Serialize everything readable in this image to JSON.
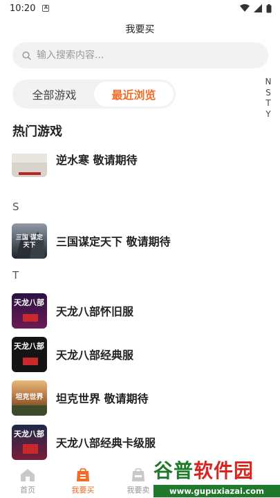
{
  "status_bar": {
    "time": "10:20",
    "sim_label": "A"
  },
  "header": {
    "title": "我要买"
  },
  "search": {
    "placeholder": "输入搜索内容..."
  },
  "tabs": [
    {
      "label": "全部游戏",
      "active": false
    },
    {
      "label": "最近浏览",
      "active": true
    }
  ],
  "alpha_index": [
    "N",
    "S",
    "T",
    "Y"
  ],
  "section_title": "热门游戏",
  "groups": [
    {
      "letter": "N",
      "items": [
        {
          "name": "逆水寒 敬请期待"
        }
      ]
    },
    {
      "letter": "S",
      "items": [
        {
          "name": "三国谋定天下 敬请期待",
          "thumb_text": "三国 谋定天下"
        }
      ]
    },
    {
      "letter": "T",
      "items": [
        {
          "name": "天龙八部怀旧服",
          "thumb_text": "天龙八部"
        },
        {
          "name": "天龙八部经典服",
          "thumb_text": "天龙八部"
        },
        {
          "name": "坦克世界 敬请期待",
          "thumb_text": "坦克世界"
        },
        {
          "name": "天龙八部经典卡级服",
          "thumb_text": "天龙八部"
        }
      ]
    }
  ],
  "bottom_nav": [
    {
      "label": "首页",
      "icon": "home-icon",
      "active": false
    },
    {
      "label": "我要买",
      "icon": "bag-icon",
      "active": true
    },
    {
      "label": "我要卖",
      "icon": "sell-icon",
      "active": false
    }
  ],
  "watermark": {
    "logo": "谷普软件园",
    "url": "www.gupuxiazai.com"
  },
  "colors": {
    "accent": "#f36b25",
    "watermark_green": "#1e7a2a",
    "watermark_red": "#d8241f"
  }
}
